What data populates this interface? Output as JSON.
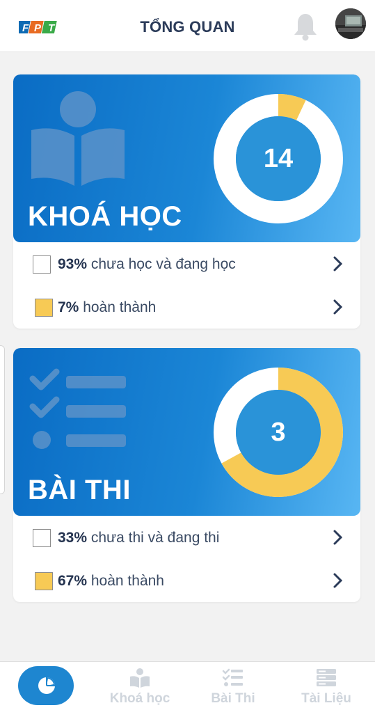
{
  "header": {
    "logo_text": "FPT",
    "title": "TỔNG QUAN"
  },
  "courses": {
    "title": "KHOÁ HỌC",
    "count": "14",
    "completed_fraction": 0.07,
    "rows": [
      {
        "percent": "93%",
        "label": "chưa học và đang học"
      },
      {
        "percent": "7%",
        "label": "hoàn thành"
      }
    ]
  },
  "exams": {
    "title": "BÀI THI",
    "count": "3",
    "completed_fraction": 0.67,
    "rows": [
      {
        "percent": "33%",
        "label": "chưa thi và đang thi"
      },
      {
        "percent": "67%",
        "label": "hoàn thành"
      }
    ]
  },
  "nav": {
    "items": [
      {
        "label": "",
        "icon": "pie-chart-icon",
        "active": true
      },
      {
        "label": "Khoá học",
        "icon": "book-reader-icon",
        "active": false
      },
      {
        "label": "Bài Thi",
        "icon": "checklist-icon",
        "active": false
      },
      {
        "label": "Tài Liệu",
        "icon": "server-icon",
        "active": false
      }
    ]
  },
  "colors": {
    "brand_blue": "#1e86d0",
    "completed": "#f7ca55",
    "remaining": "#ffffff",
    "title_text": "#2b3b59"
  }
}
